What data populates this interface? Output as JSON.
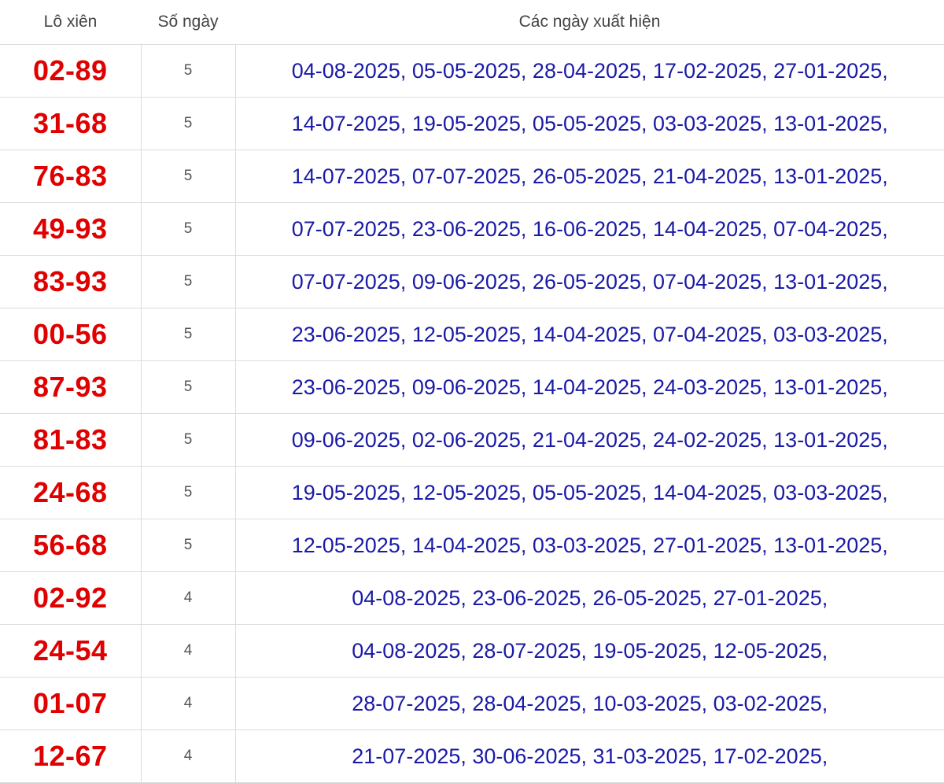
{
  "table": {
    "headers": {
      "pair": "Lô xiên",
      "count": "Số ngày",
      "dates": "Các ngày xuất hiện"
    },
    "rows": [
      {
        "pair": "02-89",
        "count": "5",
        "dates": "04-08-2025, 05-05-2025, 28-04-2025, 17-02-2025, 27-01-2025,"
      },
      {
        "pair": "31-68",
        "count": "5",
        "dates": "14-07-2025, 19-05-2025, 05-05-2025, 03-03-2025, 13-01-2025,"
      },
      {
        "pair": "76-83",
        "count": "5",
        "dates": "14-07-2025, 07-07-2025, 26-05-2025, 21-04-2025, 13-01-2025,"
      },
      {
        "pair": "49-93",
        "count": "5",
        "dates": "07-07-2025, 23-06-2025, 16-06-2025, 14-04-2025, 07-04-2025,"
      },
      {
        "pair": "83-93",
        "count": "5",
        "dates": "07-07-2025, 09-06-2025, 26-05-2025, 07-04-2025, 13-01-2025,"
      },
      {
        "pair": "00-56",
        "count": "5",
        "dates": "23-06-2025, 12-05-2025, 14-04-2025, 07-04-2025, 03-03-2025,"
      },
      {
        "pair": "87-93",
        "count": "5",
        "dates": "23-06-2025, 09-06-2025, 14-04-2025, 24-03-2025, 13-01-2025,"
      },
      {
        "pair": "81-83",
        "count": "5",
        "dates": "09-06-2025, 02-06-2025, 21-04-2025, 24-02-2025, 13-01-2025,"
      },
      {
        "pair": "24-68",
        "count": "5",
        "dates": "19-05-2025, 12-05-2025, 05-05-2025, 14-04-2025, 03-03-2025,"
      },
      {
        "pair": "56-68",
        "count": "5",
        "dates": "12-05-2025, 14-04-2025, 03-03-2025, 27-01-2025, 13-01-2025,"
      },
      {
        "pair": "02-92",
        "count": "4",
        "dates": "04-08-2025, 23-06-2025, 26-05-2025, 27-01-2025,"
      },
      {
        "pair": "24-54",
        "count": "4",
        "dates": "04-08-2025, 28-07-2025, 19-05-2025, 12-05-2025,"
      },
      {
        "pair": "01-07",
        "count": "4",
        "dates": "28-07-2025, 28-04-2025, 10-03-2025, 03-02-2025,"
      },
      {
        "pair": "12-67",
        "count": "4",
        "dates": "21-07-2025, 30-06-2025, 31-03-2025, 17-02-2025,"
      }
    ]
  },
  "colors": {
    "pair_text": "#e00000",
    "dates_text": "#1a1aa6",
    "header_text": "#444444",
    "grid_line": "#dcdcdc"
  }
}
